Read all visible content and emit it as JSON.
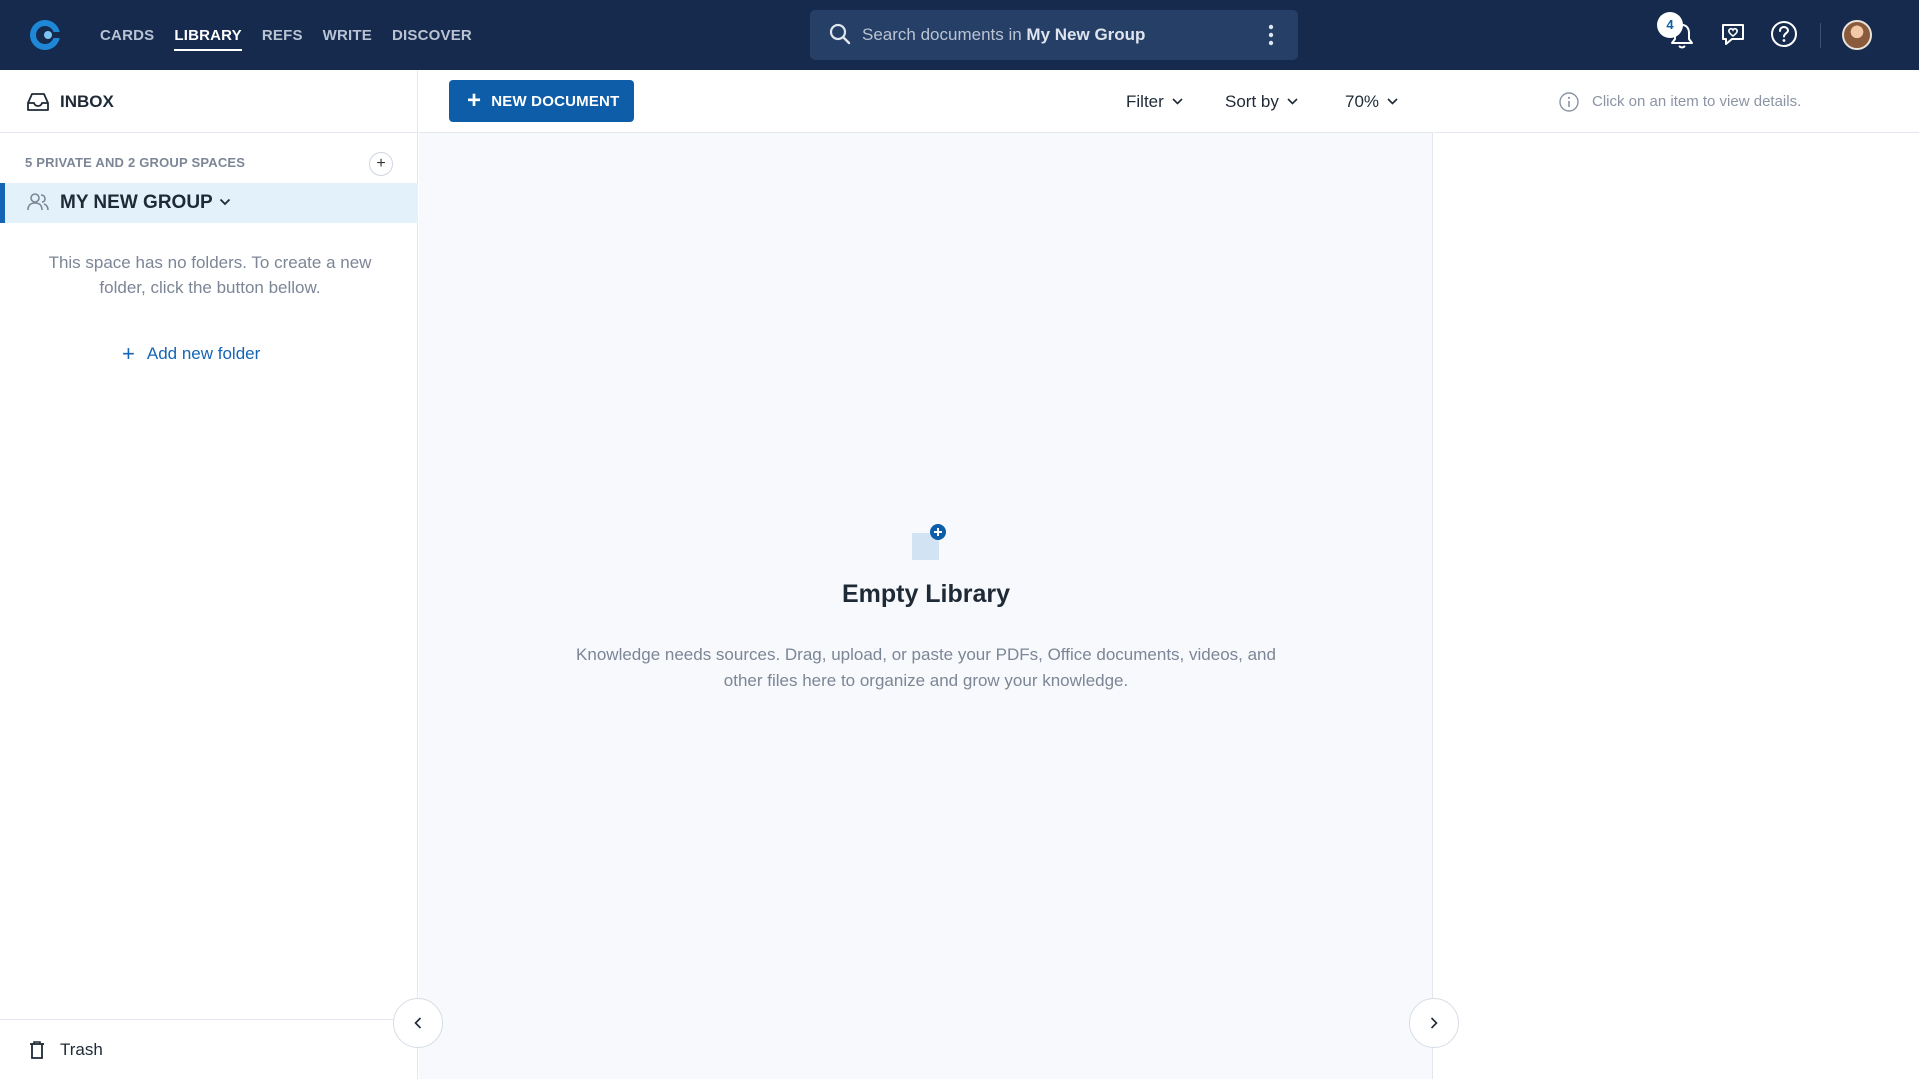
{
  "topbar": {
    "nav": [
      "CARDS",
      "LIBRARY",
      "REFS",
      "WRITE",
      "DISCOVER"
    ],
    "active_nav": "LIBRARY",
    "search": {
      "prefix": "Search documents in ",
      "scope": "My New Group"
    },
    "notification_count": "4",
    "colors": {
      "bar": "#152a4d",
      "search": "#263f66",
      "accent": "#0e5da8"
    }
  },
  "sidebar": {
    "inbox_label": "INBOX",
    "spaces_heading": "5 PRIVATE AND 2 GROUP SPACES",
    "spaces_add": "+",
    "group_label": "MY NEW GROUP",
    "empty_text": "This space has no folders. To create a new folder, click the button bellow.",
    "add_folder_plus": "+",
    "add_folder_label": "Add new folder",
    "trash_label": "Trash"
  },
  "toolbar": {
    "new_doc_plus": "+",
    "new_doc_label": "NEW DOCUMENT",
    "filter_label": "Filter",
    "sort_label": "Sort by",
    "zoom_label": "70%"
  },
  "main": {
    "empty_title": "Empty Library",
    "empty_text": "Knowledge needs sources. Drag, upload, or paste your PDFs, Office documents, videos, and other files here to organize and grow your knowledge."
  },
  "details": {
    "hint": "Click on an item to view details."
  }
}
